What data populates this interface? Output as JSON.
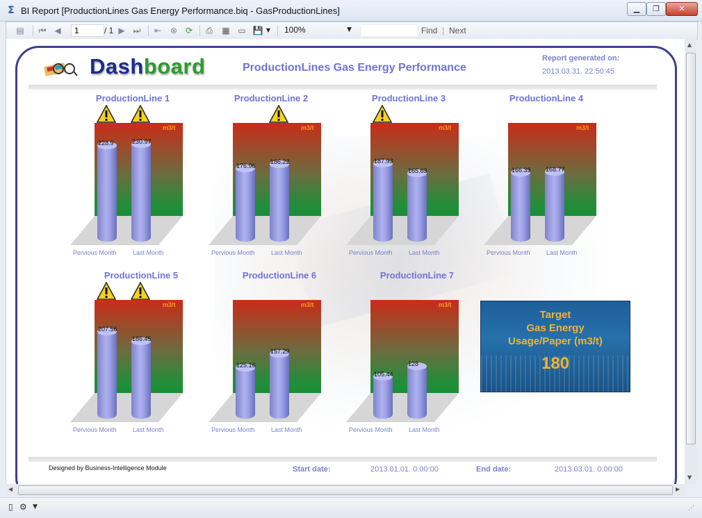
{
  "window": {
    "title": "BI Report [ProductionLines Gas Energy Performance.biq - GasProductionLines]",
    "app_icon": "sigma-icon",
    "minimize_icon": "minimize-icon",
    "maximize_icon": "maximize-icon",
    "close_icon": "close-icon"
  },
  "toolbar": {
    "page_current": "1",
    "page_total": "/ 1",
    "zoom": "100%",
    "find_label": "Find",
    "separator": "|",
    "next_label": "Next"
  },
  "report": {
    "logo_part1": "Dash",
    "logo_part2": "board",
    "title": "ProductionLines Gas Energy Performance",
    "generated_label": "Report generated on:",
    "generated_value": "2013.03.31. 22:50:45",
    "unit": "m3/t",
    "x_labels": [
      "Pervious Month",
      "Last Month"
    ],
    "footer_credit": "Designed by Business-Intelligence Module",
    "start_label": "Start date:",
    "start_value": "2013.01.01. 0:00:00",
    "end_label": "End date:",
    "end_value": "2013.03.01. 0:00:00",
    "target": {
      "line1": "Target",
      "line2": "Gas Energy",
      "line3": "Usage/Paper (m3/t)",
      "value": "180"
    },
    "colors": {
      "title": "#6f73d6",
      "bar": "#9da1e6",
      "warning": "#f5d020",
      "target_text": "#f2b233"
    }
  },
  "chart_data": [
    {
      "type": "bar",
      "title": "ProductionLine 1",
      "categories": [
        "Pervious Month",
        "Last Month"
      ],
      "values": [
        228.9,
        230.97
      ],
      "labels": [
        "228.9",
        "230.97"
      ],
      "warnings": [
        true,
        true
      ],
      "ylabel": "m3/t"
    },
    {
      "type": "bar",
      "title": "ProductionLine 2",
      "categories": [
        "Pervious Month",
        "Last Month"
      ],
      "values": [
        176.96,
        186.22
      ],
      "labels": [
        "176.96",
        "186.22"
      ],
      "warnings": [
        false,
        true
      ],
      "ylabel": "m3/t"
    },
    {
      "type": "bar",
      "title": "ProductionLine 3",
      "categories": [
        "Pervious Month",
        "Last Month"
      ],
      "values": [
        187.93,
        165.63
      ],
      "labels": [
        "187.93",
        "165.63"
      ],
      "warnings": [
        true,
        false
      ],
      "ylabel": "m3/t"
    },
    {
      "type": "bar",
      "title": "ProductionLine 4",
      "categories": [
        "Pervious Month",
        "Last Month"
      ],
      "values": [
        166.33,
        168.77
      ],
      "labels": [
        "166.33",
        "168.77"
      ],
      "warnings": [
        false,
        false
      ],
      "ylabel": "m3/t"
    },
    {
      "type": "bar",
      "title": "ProductionLine 5",
      "categories": [
        "Pervious Month",
        "Last Month"
      ],
      "values": [
        207.56,
        186.45
      ],
      "labels": [
        "207.56",
        "186.45"
      ],
      "warnings": [
        true,
        true
      ],
      "ylabel": "m3/t"
    },
    {
      "type": "bar",
      "title": "ProductionLine 6",
      "categories": [
        "Pervious Month",
        "Last Month"
      ],
      "values": [
        125.16,
        157.29
      ],
      "labels": [
        "125.16",
        "157.29"
      ],
      "warnings": [
        false,
        false
      ],
      "ylabel": "m3/t"
    },
    {
      "type": "bar",
      "title": "ProductionLine 7",
      "categories": [
        "Pervious Month",
        "Last Month"
      ],
      "values": [
        105.44,
        128
      ],
      "labels": [
        "105.44",
        "128"
      ],
      "warnings": [
        false,
        false
      ],
      "ylabel": "m3/t"
    }
  ]
}
